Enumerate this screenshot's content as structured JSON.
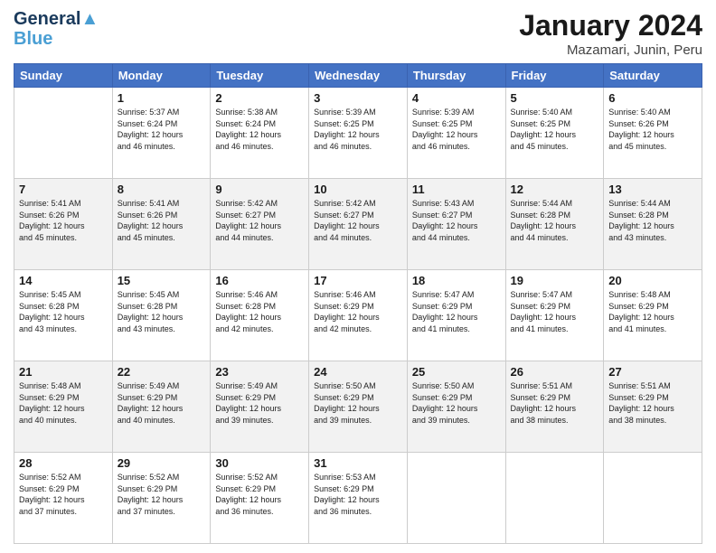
{
  "logo": {
    "line1": "General",
    "line2": "Blue"
  },
  "title": "January 2024",
  "subtitle": "Mazamari, Junin, Peru",
  "days_of_week": [
    "Sunday",
    "Monday",
    "Tuesday",
    "Wednesday",
    "Thursday",
    "Friday",
    "Saturday"
  ],
  "weeks": [
    [
      {
        "day": "",
        "info": ""
      },
      {
        "day": "1",
        "info": "Sunrise: 5:37 AM\nSunset: 6:24 PM\nDaylight: 12 hours\nand 46 minutes."
      },
      {
        "day": "2",
        "info": "Sunrise: 5:38 AM\nSunset: 6:24 PM\nDaylight: 12 hours\nand 46 minutes."
      },
      {
        "day": "3",
        "info": "Sunrise: 5:39 AM\nSunset: 6:25 PM\nDaylight: 12 hours\nand 46 minutes."
      },
      {
        "day": "4",
        "info": "Sunrise: 5:39 AM\nSunset: 6:25 PM\nDaylight: 12 hours\nand 46 minutes."
      },
      {
        "day": "5",
        "info": "Sunrise: 5:40 AM\nSunset: 6:25 PM\nDaylight: 12 hours\nand 45 minutes."
      },
      {
        "day": "6",
        "info": "Sunrise: 5:40 AM\nSunset: 6:26 PM\nDaylight: 12 hours\nand 45 minutes."
      }
    ],
    [
      {
        "day": "7",
        "info": "Sunrise: 5:41 AM\nSunset: 6:26 PM\nDaylight: 12 hours\nand 45 minutes."
      },
      {
        "day": "8",
        "info": "Sunrise: 5:41 AM\nSunset: 6:26 PM\nDaylight: 12 hours\nand 45 minutes."
      },
      {
        "day": "9",
        "info": "Sunrise: 5:42 AM\nSunset: 6:27 PM\nDaylight: 12 hours\nand 44 minutes."
      },
      {
        "day": "10",
        "info": "Sunrise: 5:42 AM\nSunset: 6:27 PM\nDaylight: 12 hours\nand 44 minutes."
      },
      {
        "day": "11",
        "info": "Sunrise: 5:43 AM\nSunset: 6:27 PM\nDaylight: 12 hours\nand 44 minutes."
      },
      {
        "day": "12",
        "info": "Sunrise: 5:44 AM\nSunset: 6:28 PM\nDaylight: 12 hours\nand 44 minutes."
      },
      {
        "day": "13",
        "info": "Sunrise: 5:44 AM\nSunset: 6:28 PM\nDaylight: 12 hours\nand 43 minutes."
      }
    ],
    [
      {
        "day": "14",
        "info": "Sunrise: 5:45 AM\nSunset: 6:28 PM\nDaylight: 12 hours\nand 43 minutes."
      },
      {
        "day": "15",
        "info": "Sunrise: 5:45 AM\nSunset: 6:28 PM\nDaylight: 12 hours\nand 43 minutes."
      },
      {
        "day": "16",
        "info": "Sunrise: 5:46 AM\nSunset: 6:28 PM\nDaylight: 12 hours\nand 42 minutes."
      },
      {
        "day": "17",
        "info": "Sunrise: 5:46 AM\nSunset: 6:29 PM\nDaylight: 12 hours\nand 42 minutes."
      },
      {
        "day": "18",
        "info": "Sunrise: 5:47 AM\nSunset: 6:29 PM\nDaylight: 12 hours\nand 41 minutes."
      },
      {
        "day": "19",
        "info": "Sunrise: 5:47 AM\nSunset: 6:29 PM\nDaylight: 12 hours\nand 41 minutes."
      },
      {
        "day": "20",
        "info": "Sunrise: 5:48 AM\nSunset: 6:29 PM\nDaylight: 12 hours\nand 41 minutes."
      }
    ],
    [
      {
        "day": "21",
        "info": "Sunrise: 5:48 AM\nSunset: 6:29 PM\nDaylight: 12 hours\nand 40 minutes."
      },
      {
        "day": "22",
        "info": "Sunrise: 5:49 AM\nSunset: 6:29 PM\nDaylight: 12 hours\nand 40 minutes."
      },
      {
        "day": "23",
        "info": "Sunrise: 5:49 AM\nSunset: 6:29 PM\nDaylight: 12 hours\nand 39 minutes."
      },
      {
        "day": "24",
        "info": "Sunrise: 5:50 AM\nSunset: 6:29 PM\nDaylight: 12 hours\nand 39 minutes."
      },
      {
        "day": "25",
        "info": "Sunrise: 5:50 AM\nSunset: 6:29 PM\nDaylight: 12 hours\nand 39 minutes."
      },
      {
        "day": "26",
        "info": "Sunrise: 5:51 AM\nSunset: 6:29 PM\nDaylight: 12 hours\nand 38 minutes."
      },
      {
        "day": "27",
        "info": "Sunrise: 5:51 AM\nSunset: 6:29 PM\nDaylight: 12 hours\nand 38 minutes."
      }
    ],
    [
      {
        "day": "28",
        "info": "Sunrise: 5:52 AM\nSunset: 6:29 PM\nDaylight: 12 hours\nand 37 minutes."
      },
      {
        "day": "29",
        "info": "Sunrise: 5:52 AM\nSunset: 6:29 PM\nDaylight: 12 hours\nand 37 minutes."
      },
      {
        "day": "30",
        "info": "Sunrise: 5:52 AM\nSunset: 6:29 PM\nDaylight: 12 hours\nand 36 minutes."
      },
      {
        "day": "31",
        "info": "Sunrise: 5:53 AM\nSunset: 6:29 PM\nDaylight: 12 hours\nand 36 minutes."
      },
      {
        "day": "",
        "info": ""
      },
      {
        "day": "",
        "info": ""
      },
      {
        "day": "",
        "info": ""
      }
    ]
  ]
}
